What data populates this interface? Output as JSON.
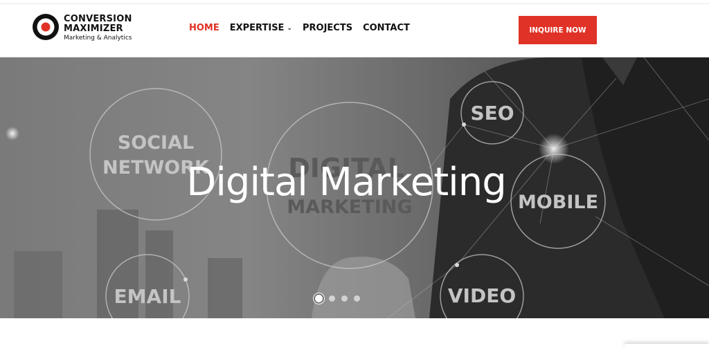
{
  "brand": {
    "name_line1": "CONVERSION",
    "name_line2": "MAXIMIZER",
    "tagline": "Marketing & Analytics",
    "accent": "#e03226"
  },
  "nav": {
    "items": [
      {
        "label": "HOME",
        "active": true
      },
      {
        "label": "EXPERTISE",
        "has_dropdown": true
      },
      {
        "label": "PROJECTS"
      },
      {
        "label": "CONTACT"
      }
    ],
    "cta": "INQUIRE NOW"
  },
  "hero": {
    "title": "Digital Marketing",
    "bubbles": {
      "social_1": "SOCIAL",
      "social_2": "NETWORK",
      "digital": "DIGITAL",
      "marketing": "MARKETING",
      "seo": "SEO",
      "mobile": "MOBILE",
      "email": "EMAIL",
      "video": "VIDEO"
    },
    "slides": 4,
    "active_slide": 1
  }
}
